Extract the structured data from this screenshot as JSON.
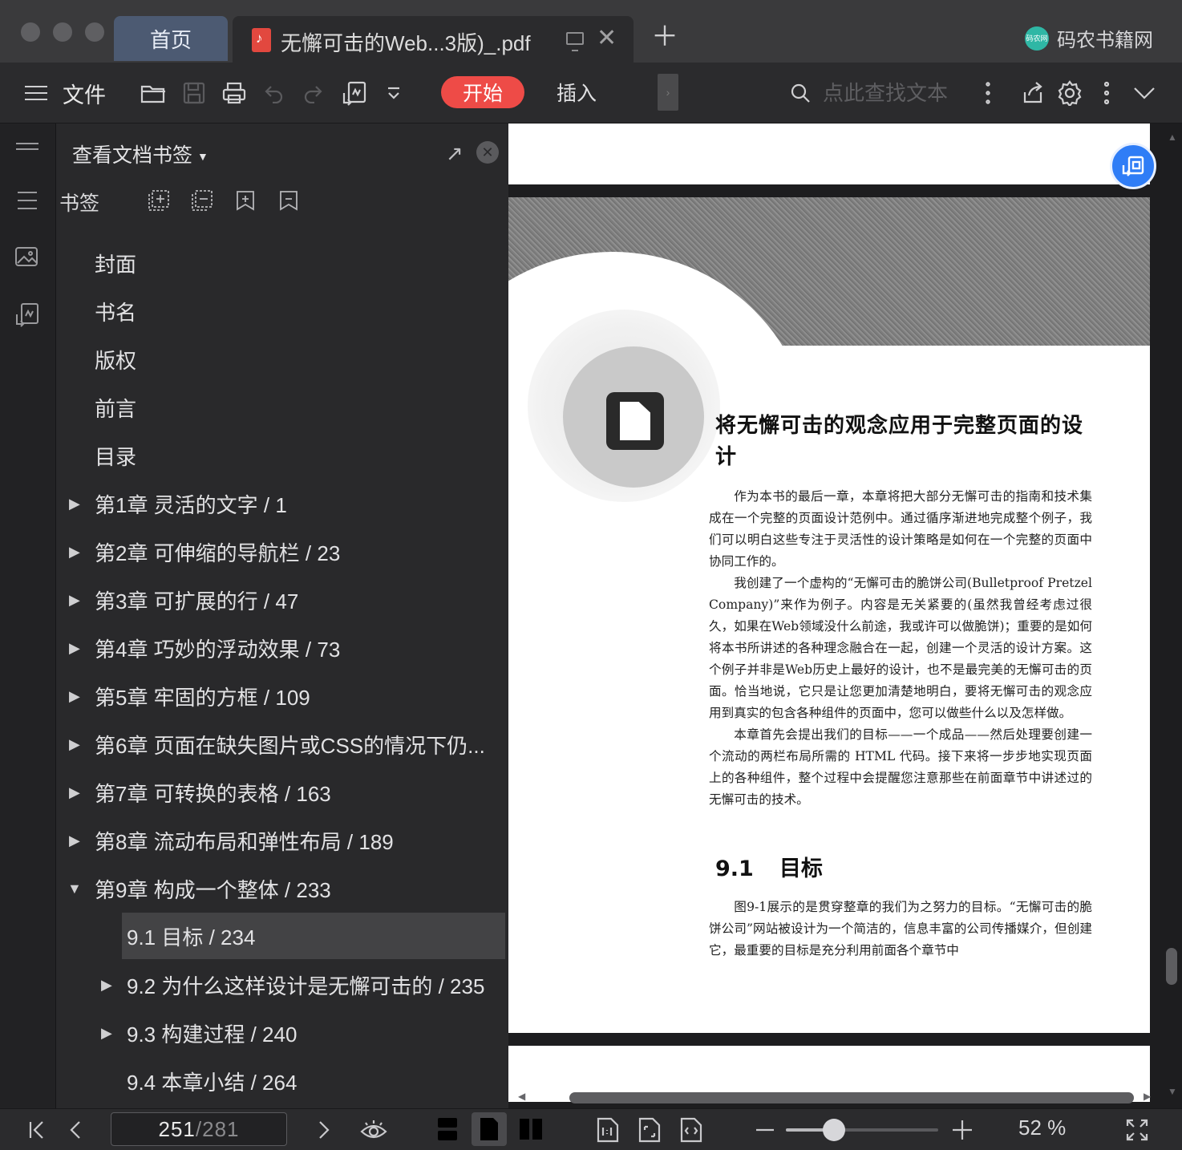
{
  "tabs": {
    "home": "首页",
    "document": "无懈可击的Web...3版)_.pdf",
    "brand": "码农书籍网",
    "brand_logo_text": "码农网"
  },
  "toolbar": {
    "file": "文件",
    "start": "开始",
    "insert": "插入",
    "search_placeholder": "点此查找文本",
    "icons": [
      "menu-icon",
      "open-folder-icon",
      "save-icon",
      "print-icon",
      "undo-icon",
      "redo-icon",
      "pdf-convert-icon",
      "dropdown-icon",
      "search-icon",
      "more-vertical-icon",
      "share-icon",
      "settings-icon",
      "more-icon",
      "chevron-down-icon"
    ]
  },
  "sidebar": {
    "header": "查看文档书签",
    "bookmarks_label": "书签",
    "items": [
      {
        "label": "封面",
        "level": 0,
        "expander": "none"
      },
      {
        "label": "书名",
        "level": 0,
        "expander": "none"
      },
      {
        "label": "版权",
        "level": 0,
        "expander": "none"
      },
      {
        "label": "前言",
        "level": 0,
        "expander": "none"
      },
      {
        "label": "目录",
        "level": 0,
        "expander": "none"
      },
      {
        "label": "第1章 灵活的文字 / 1",
        "level": 0,
        "expander": "collapsed"
      },
      {
        "label": "第2章 可伸缩的导航栏 / 23",
        "level": 0,
        "expander": "collapsed"
      },
      {
        "label": "第3章 可扩展的行 / 47",
        "level": 0,
        "expander": "collapsed"
      },
      {
        "label": "第4章 巧妙的浮动效果 / 73",
        "level": 0,
        "expander": "collapsed"
      },
      {
        "label": "第5章 牢固的方框 / 109",
        "level": 0,
        "expander": "collapsed"
      },
      {
        "label": "第6章 页面在缺失图片或CSS的情况下仍...",
        "level": 0,
        "expander": "collapsed"
      },
      {
        "label": "第7章 可转换的表格 / 163",
        "level": 0,
        "expander": "collapsed"
      },
      {
        "label": "第8章 流动布局和弹性布局 / 189",
        "level": 0,
        "expander": "collapsed"
      },
      {
        "label": "第9章 构成一个整体 / 233",
        "level": 0,
        "expander": "expanded"
      },
      {
        "label": "9.1 目标 / 234",
        "level": 1,
        "expander": "none",
        "selected": true
      },
      {
        "label": "9.2 为什么这样设计是无懈可击的 / 235",
        "level": 1,
        "expander": "collapsed"
      },
      {
        "label": "9.3 构建过程 / 240",
        "level": 1,
        "expander": "collapsed"
      },
      {
        "label": "9.4 本章小结 / 264",
        "level": 1,
        "expander": "none"
      }
    ]
  },
  "page": {
    "chapter_title": "将无懈可击的观念应用于完整页面的设计",
    "paragraphs": [
      "作为本书的最后一章，本章将把大部分无懈可击的指南和技术集成在一个完整的页面设计范例中。通过循序渐进地完成整个例子，我们可以明白这些专注于灵活性的设计策略是如何在一个完整的页面中协同工作的。",
      "我创建了一个虚构的“无懈可击的脆饼公司(Bulletproof Pretzel Company)”来作为例子。内容是无关紧要的(虽然我曾经考虑过很久，如果在Web领域没什么前途，我或许可以做脆饼)；重要的是如何将本书所讲述的各种理念融合在一起，创建一个灵活的设计方案。这个例子并非是Web历史上最好的设计，也不是最完美的无懈可击的页面。恰当地说，它只是让您更加清楚地明白，要将无懈可击的观念应用到真实的包含各种组件的页面中，您可以做些什么以及怎样做。",
      "本章首先会提出我们的目标——一个成品——然后处理要创建一个流动的两栏布局所需的 HTML 代码。接下来将一步步地实现页面上的各种组件，整个过程中会提醒您注意那些在前面章节中讲述过的无懈可击的技术。"
    ],
    "section_number": "9.1",
    "section_title": "目标",
    "section_paragraph": "图9-1展示的是贯穿整章的我们为之努力的目标。“无懈可击的脆饼公司”网站被设计为一个简洁的，信息丰富的公司传播媒介，但创建它，最重要的目标是充分利用前面各个章节中"
  },
  "status": {
    "current_page": "251",
    "total_pages": "/281",
    "zoom": "52 %",
    "zoom_fraction": 0.3
  }
}
